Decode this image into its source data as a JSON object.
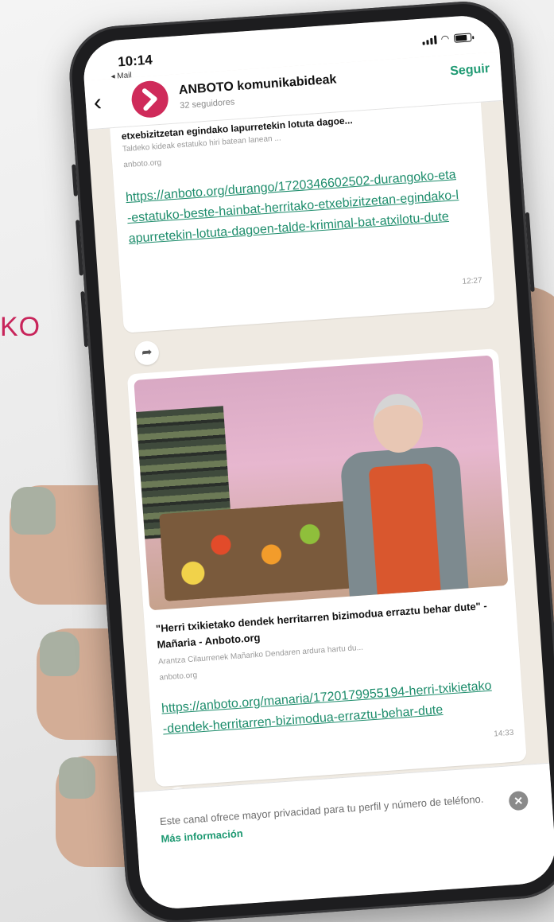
{
  "background": {
    "text": "KO"
  },
  "status_bar": {
    "time": "10:14",
    "back_app": "◂ Mail"
  },
  "header": {
    "back_glyph": "‹",
    "channel_name": "ANBOTO komunikabideak",
    "followers": "32 seguidores",
    "follow_label": "Seguir"
  },
  "messages": [
    {
      "preview_title": "etxebizitzetan egindako lapurretekin lotuta dagoe...",
      "preview_desc": "Taldeko kideak estatuko hiri batean lanean ...",
      "preview_domain": "anboto.org",
      "link": "https://anboto.org/durango/1720346602502-durangoko-eta-estatuko-beste-hainbat-herritako-etxebizitzetan-egindako-lapurretekin-lotuta-dagoen-talde-kriminal-bat-atxilotu-dute",
      "time": "12:27"
    },
    {
      "preview_title": "\"Herri txikietako dendek herritarren bizimodua erraztu behar dute\" - Mañaria - Anboto.org",
      "preview_desc": "Arantza Cilaurrenek Mañariko Dendaren ardura hartu du...",
      "preview_domain": "anboto.org",
      "link": "https://anboto.org/manaria/1720179955194-herri-txikietako-dendek-herritarren-bizimodua-erraztu-behar-dute",
      "time": "14:33"
    }
  ],
  "icons": {
    "forward": "forward-icon",
    "close": "close-icon",
    "back": "chevron-left-icon"
  },
  "footer": {
    "notice_text": "Este canal ofrece mayor privacidad para tu perfil y número de teléfono.",
    "notice_link": "Más información",
    "close_glyph": "✕"
  },
  "colors": {
    "accent_green": "#1f9a73",
    "brand_pink": "#cf2b5a",
    "chat_bg": "#efeae2"
  }
}
